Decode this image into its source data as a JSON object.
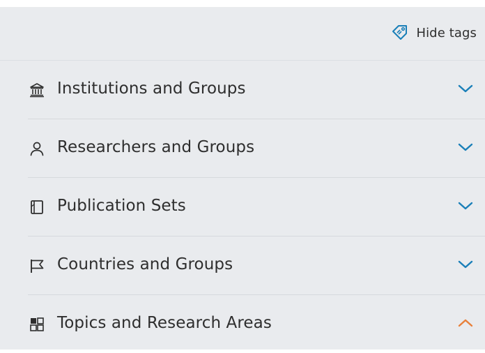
{
  "colors": {
    "panel_bg": "#e9ebee",
    "chevron_collapsed": "#1a7fb8",
    "chevron_expanded": "#e8803a",
    "text": "#2e2e2e",
    "tag_icon": "#1a7fb8"
  },
  "toolbar": {
    "hide_tags_label": "Hide tags",
    "hide_tags_icon": "tag-icon"
  },
  "filters": [
    {
      "label": "Institutions and Groups",
      "icon": "institution-icon",
      "expanded": false
    },
    {
      "label": "Researchers and Groups",
      "icon": "person-icon",
      "expanded": false
    },
    {
      "label": "Publication Sets",
      "icon": "document-icon",
      "expanded": false
    },
    {
      "label": "Countries and Groups",
      "icon": "flag-icon",
      "expanded": false
    },
    {
      "label": "Topics and Research Areas",
      "icon": "grid-icon",
      "expanded": true
    }
  ]
}
